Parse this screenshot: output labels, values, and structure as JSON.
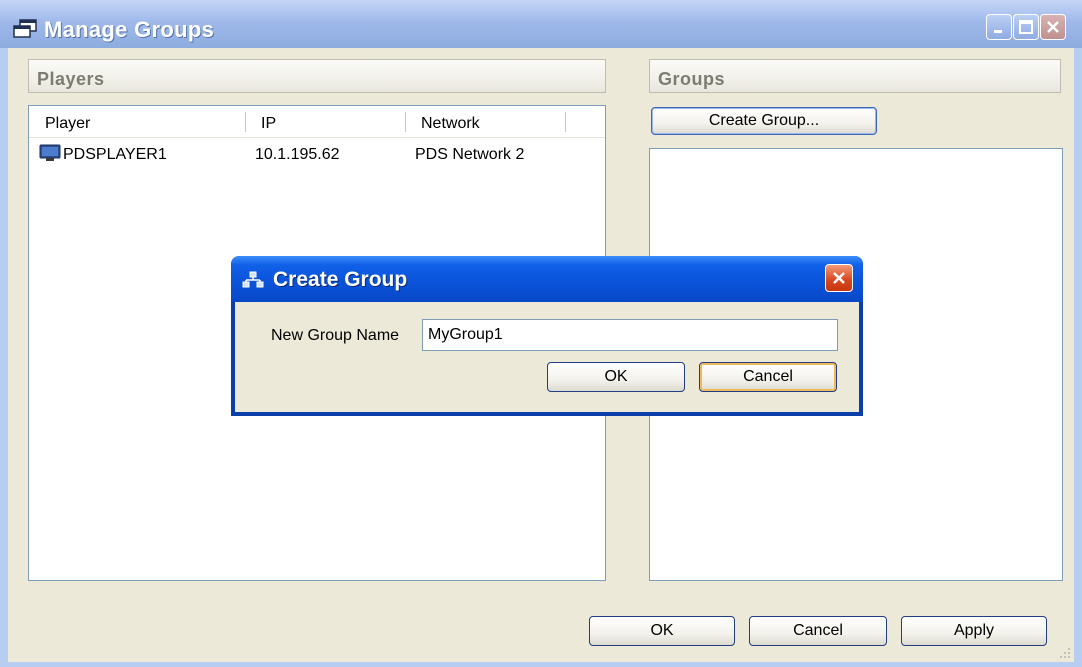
{
  "window": {
    "title": "Manage Groups"
  },
  "players": {
    "header": "Players",
    "columns": [
      "Player",
      "IP",
      "Network"
    ],
    "rows": [
      {
        "player": "PDSPLAYER1",
        "ip": "10.1.195.62",
        "network": "PDS Network 2"
      }
    ]
  },
  "groups": {
    "header": "Groups",
    "create_button": "Create Group..."
  },
  "footer": {
    "ok": "OK",
    "cancel": "Cancel",
    "apply": "Apply"
  },
  "dialog": {
    "title": "Create Group",
    "label": "New Group Name",
    "input_value": "MyGroup1",
    "ok": "OK",
    "cancel": "Cancel"
  },
  "colors": {
    "window_title_bg": "#9fb9ea",
    "dialog_title_bg": "#0a52d8",
    "client_bg": "#ece9d8",
    "default_button_highlight": "#f2b85c"
  },
  "icons": {
    "title": "window-stack-icon",
    "dialog": "group-icon",
    "player": "monitor-icon"
  }
}
